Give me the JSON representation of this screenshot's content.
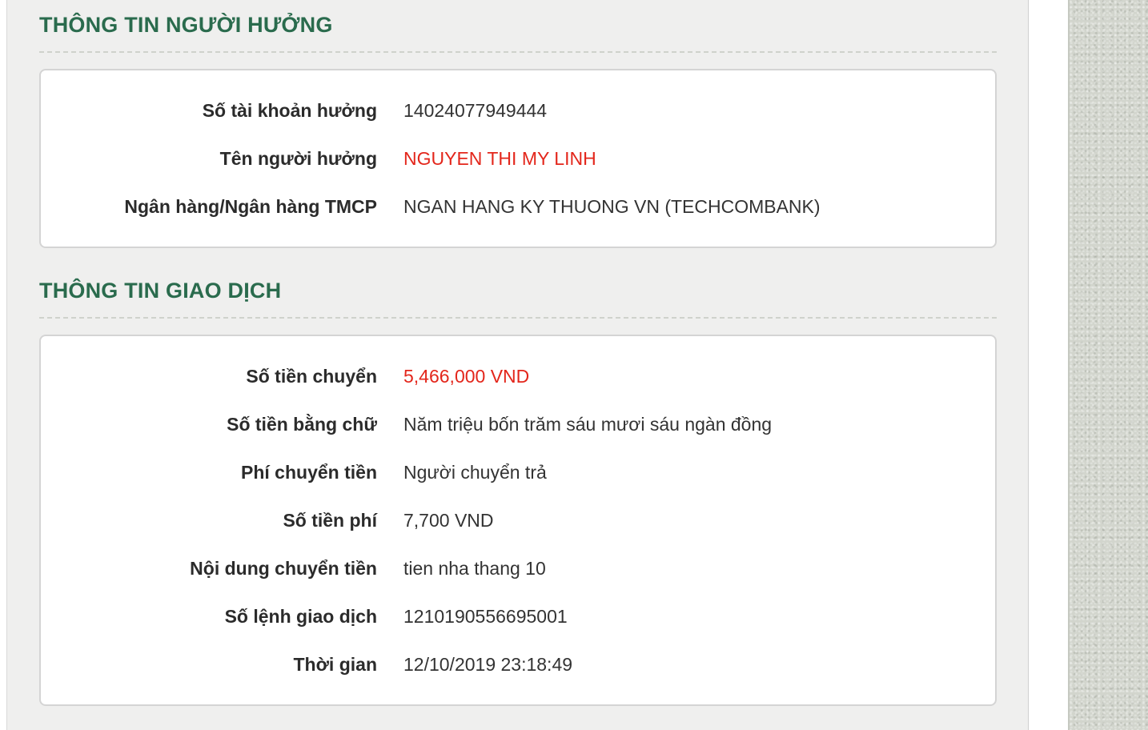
{
  "colors": {
    "section_title": "#2a6b4d",
    "highlight_value": "#e3261b",
    "panel_background": "#efefee"
  },
  "beneficiary": {
    "title": "THÔNG TIN NGƯỜI HƯỞNG",
    "rows": [
      {
        "label": "Số tài khoản hưởng",
        "value": "14024077949444"
      },
      {
        "label": "Tên người hưởng",
        "value": "NGUYEN THI MY LINH"
      },
      {
        "label": "Ngân hàng/Ngân hàng TMCP",
        "value": "NGAN HANG KY THUONG VN (TECHCOMBANK)"
      }
    ]
  },
  "transaction": {
    "title": "THÔNG TIN GIAO DỊCH",
    "rows": [
      {
        "label": "Số tiền chuyển",
        "value": "5,466,000 VND"
      },
      {
        "label": "Số tiền bằng chữ",
        "value": "Năm triệu bốn trăm sáu mươi sáu ngàn đồng"
      },
      {
        "label": "Phí chuyển tiền",
        "value": "Người chuyển trả"
      },
      {
        "label": "Số tiền phí",
        "value": "7,700 VND"
      },
      {
        "label": "Nội dung chuyển tiền",
        "value": "tien nha thang 10"
      },
      {
        "label": "Số lệnh giao dịch",
        "value": "1210190556695001"
      },
      {
        "label": "Thời gian",
        "value": "12/10/2019 23:18:49"
      }
    ]
  }
}
